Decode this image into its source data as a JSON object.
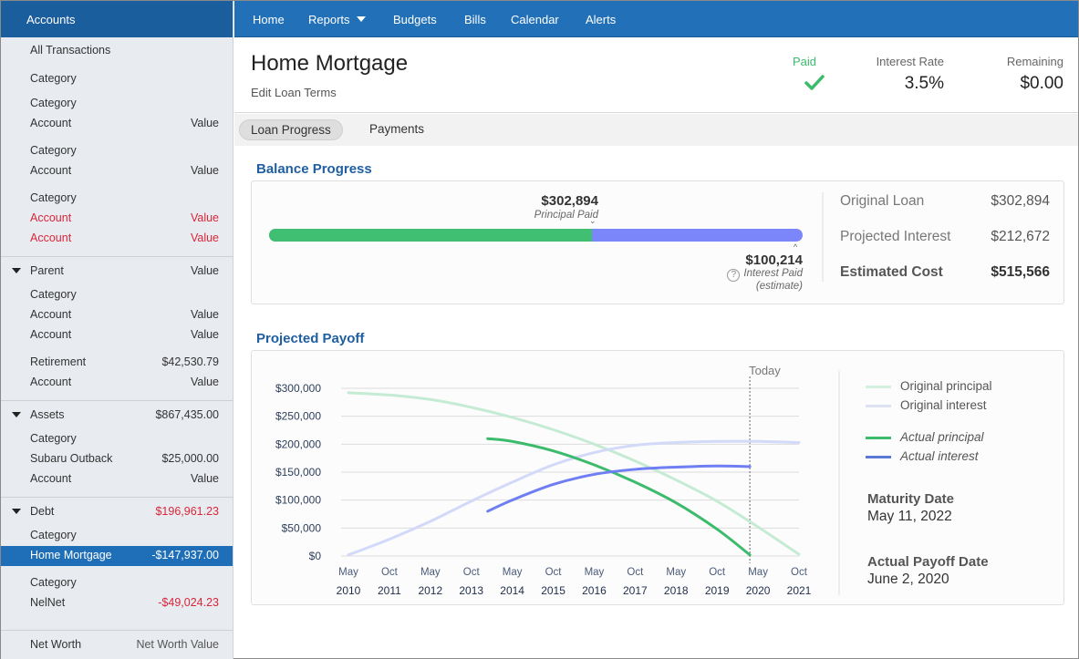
{
  "sidebar": {
    "header": "Accounts",
    "all_transactions": "All Transactions",
    "rows": [
      {
        "label": "Category",
        "value": ""
      },
      {
        "label": "Category",
        "value": ""
      },
      {
        "label": "Account",
        "value": "Value"
      },
      {
        "label": "Category",
        "value": ""
      },
      {
        "label": "Account",
        "value": "Value"
      },
      {
        "label": "Category",
        "value": ""
      },
      {
        "label": "Account",
        "value": "Value"
      },
      {
        "label": "Account",
        "value": "Value"
      }
    ],
    "parent_group": {
      "label": "Parent",
      "value": "Value",
      "rows": [
        {
          "label": "Category",
          "value": ""
        },
        {
          "label": "Account",
          "value": "Value"
        },
        {
          "label": "Account",
          "value": "Value"
        },
        {
          "label": "Retirement",
          "value": "$42,530.79"
        },
        {
          "label": "Account",
          "value": "Value"
        }
      ]
    },
    "assets_group": {
      "label": "Assets",
      "value": "$867,435.00",
      "rows": [
        {
          "label": "Category",
          "value": ""
        },
        {
          "label": "Subaru Outback",
          "value": "$25,000.00"
        },
        {
          "label": "Account",
          "value": "Value"
        }
      ]
    },
    "debt_group": {
      "label": "Debt",
      "value": "$196,961.23",
      "rows": [
        {
          "label": "Category",
          "value": ""
        },
        {
          "label": "Home Mortgage",
          "value": "-$147,937.00",
          "selected": true
        },
        {
          "label": "Category",
          "value": ""
        },
        {
          "label": "NelNet",
          "value": "-$49,024.23"
        }
      ]
    },
    "net_worth": {
      "label": "Net Worth",
      "value": "Net Worth Value"
    }
  },
  "nav": {
    "items": [
      "Home",
      "Reports",
      "Budgets",
      "Bills",
      "Calendar",
      "Alerts"
    ]
  },
  "header": {
    "title": "Home Mortgage",
    "edit_link": "Edit Loan Terms",
    "paid_label": "Paid",
    "interest_rate_label": "Interest Rate",
    "interest_rate_value": "3.5%",
    "remaining_label": "Remaining",
    "remaining_value": "$0.00"
  },
  "tabs": [
    "Loan Progress",
    "Payments"
  ],
  "balance_progress": {
    "title": "Balance Progress",
    "principal_paid_amount": "$302,894",
    "principal_paid_label": "Principal Paid",
    "interest_paid_amount": "$100,214",
    "interest_paid_label": "Interest Paid",
    "interest_paid_note": "(estimate)",
    "principal_fraction": 0.605,
    "summary": [
      {
        "label": "Original Loan",
        "value": "$302,894"
      },
      {
        "label": "Projected Interest",
        "value": "$212,672"
      },
      {
        "label": "Estimated Cost",
        "value": "$515,566"
      }
    ],
    "colors": {
      "principal": "#40bf73",
      "interest": "#7b86fb"
    }
  },
  "projected_payoff": {
    "title": "Projected Payoff",
    "today_label": "Today",
    "legend": [
      {
        "label": "Original principal",
        "color": "#c8ecd6"
      },
      {
        "label": "Original interest",
        "color": "#d6dcf5"
      },
      {
        "label": "Actual principal",
        "color": "#3dbb6c"
      },
      {
        "label": "Actual interest",
        "color": "#5a79d6"
      }
    ],
    "maturity_label": "Maturity Date",
    "maturity_value": "May 11, 2022",
    "payoff_label": "Actual Payoff Date",
    "payoff_value": "June 2, 2020"
  },
  "chart_data": {
    "type": "line",
    "title": "Projected Payoff",
    "xlabel": "",
    "ylabel": "",
    "x_ticks": [
      [
        "May",
        "2010"
      ],
      [
        "Oct",
        "2011"
      ],
      [
        "May",
        "2012"
      ],
      [
        "Oct",
        "2013"
      ],
      [
        "May",
        "2014"
      ],
      [
        "Oct",
        "2015"
      ],
      [
        "May",
        "2016"
      ],
      [
        "Oct",
        "2017"
      ],
      [
        "May",
        "2018"
      ],
      [
        "Oct",
        "2019"
      ],
      [
        "May",
        "2020"
      ],
      [
        "Oct",
        "2021"
      ]
    ],
    "y_ticks": [
      "$0",
      "$50,000",
      "$100,000",
      "$150,000",
      "$200,000",
      "$250,000",
      "$300,000"
    ],
    "ylim": [
      0,
      300000
    ],
    "xlim": [
      0,
      11
    ],
    "today_x": 9.8,
    "grid": true,
    "legend_position": "right",
    "series": [
      {
        "name": "Original principal",
        "color": "#c6ebd4",
        "points": [
          [
            0,
            292000
          ],
          [
            1,
            288000
          ],
          [
            2,
            280000
          ],
          [
            3,
            266000
          ],
          [
            4,
            248000
          ],
          [
            5,
            226000
          ],
          [
            6,
            200000
          ],
          [
            7,
            170000
          ],
          [
            8,
            136000
          ],
          [
            9,
            98000
          ],
          [
            10,
            52000
          ],
          [
            11,
            3000
          ]
        ]
      },
      {
        "name": "Original interest",
        "color": "#d3d9f8",
        "points": [
          [
            0,
            2000
          ],
          [
            1,
            30000
          ],
          [
            2,
            62000
          ],
          [
            3,
            98000
          ],
          [
            4,
            132000
          ],
          [
            5,
            163000
          ],
          [
            6,
            185000
          ],
          [
            7,
            198000
          ],
          [
            8,
            203000
          ],
          [
            9,
            205000
          ],
          [
            10,
            205000
          ],
          [
            11,
            203000
          ]
        ]
      },
      {
        "name": "Actual principal",
        "color": "#3dbb6c",
        "points": [
          [
            3.4,
            210000
          ],
          [
            4,
            205000
          ],
          [
            5,
            188000
          ],
          [
            6,
            163000
          ],
          [
            7,
            132000
          ],
          [
            8,
            95000
          ],
          [
            9,
            48000
          ],
          [
            9.8,
            2000
          ]
        ]
      },
      {
        "name": "Actual interest",
        "color": "#6f7ef2",
        "points": [
          [
            3.4,
            80000
          ],
          [
            4,
            100000
          ],
          [
            5,
            128000
          ],
          [
            6,
            146000
          ],
          [
            7,
            155000
          ],
          [
            8,
            159000
          ],
          [
            9,
            161000
          ],
          [
            9.8,
            160000
          ]
        ]
      }
    ]
  }
}
